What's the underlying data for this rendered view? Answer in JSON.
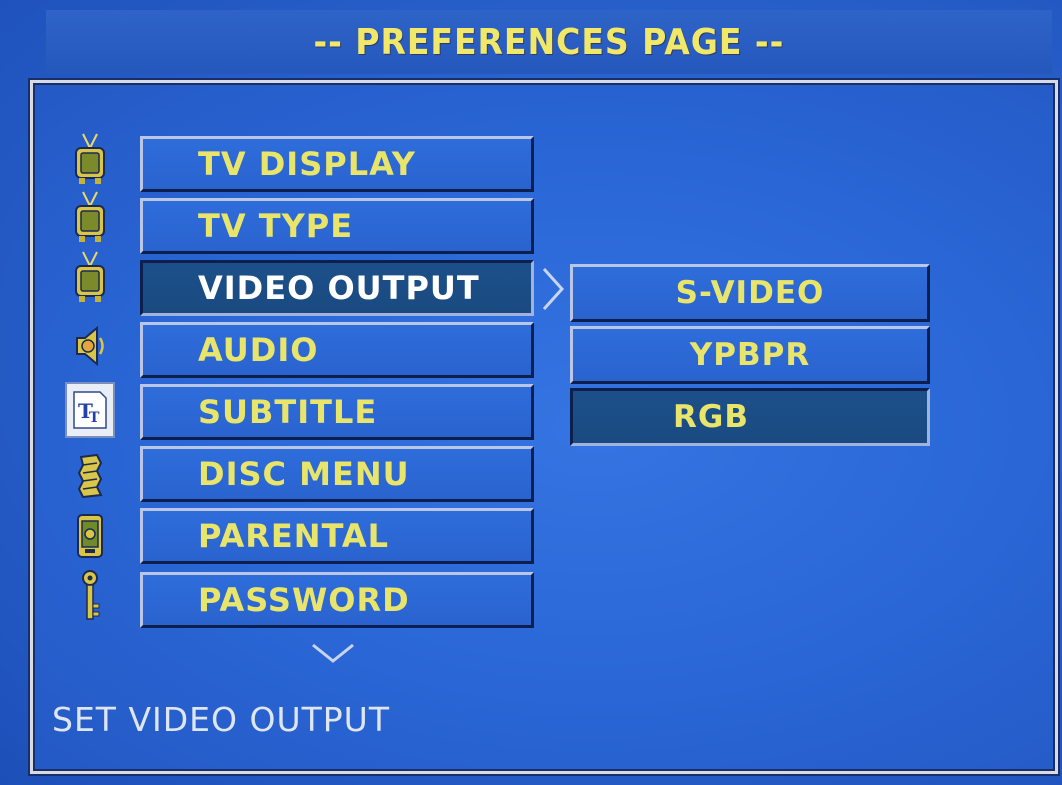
{
  "header": {
    "title": "-- PREFERENCES PAGE --"
  },
  "icons": [
    {
      "name": "tv-icon"
    },
    {
      "name": "tv-icon"
    },
    {
      "name": "tv-icon"
    },
    {
      "name": "speaker-icon"
    },
    {
      "name": "subtitle-tt-icon"
    },
    {
      "name": "disc-menu-icon"
    },
    {
      "name": "parental-icon"
    },
    {
      "name": "key-icon"
    }
  ],
  "menu": {
    "items": [
      {
        "label": "TV DISPLAY"
      },
      {
        "label": "TV TYPE"
      },
      {
        "label": "VIDEO OUTPUT",
        "selected": true
      },
      {
        "label": "AUDIO"
      },
      {
        "label": "SUBTITLE"
      },
      {
        "label": "DISC MENU"
      },
      {
        "label": "PARENTAL"
      },
      {
        "label": "PASSWORD"
      }
    ]
  },
  "submenu": {
    "items": [
      {
        "label": "S-VIDEO"
      },
      {
        "label": "YPBPR"
      },
      {
        "label": "RGB",
        "selected": true
      }
    ]
  },
  "status": {
    "text": "SET VIDEO OUTPUT"
  },
  "colors": {
    "background": "#2a63cf",
    "label_yellow": "#e9e56a",
    "selected_bg": "#1a4a80",
    "selected_text": "#ffffff",
    "status_text": "#dfe6f3"
  }
}
